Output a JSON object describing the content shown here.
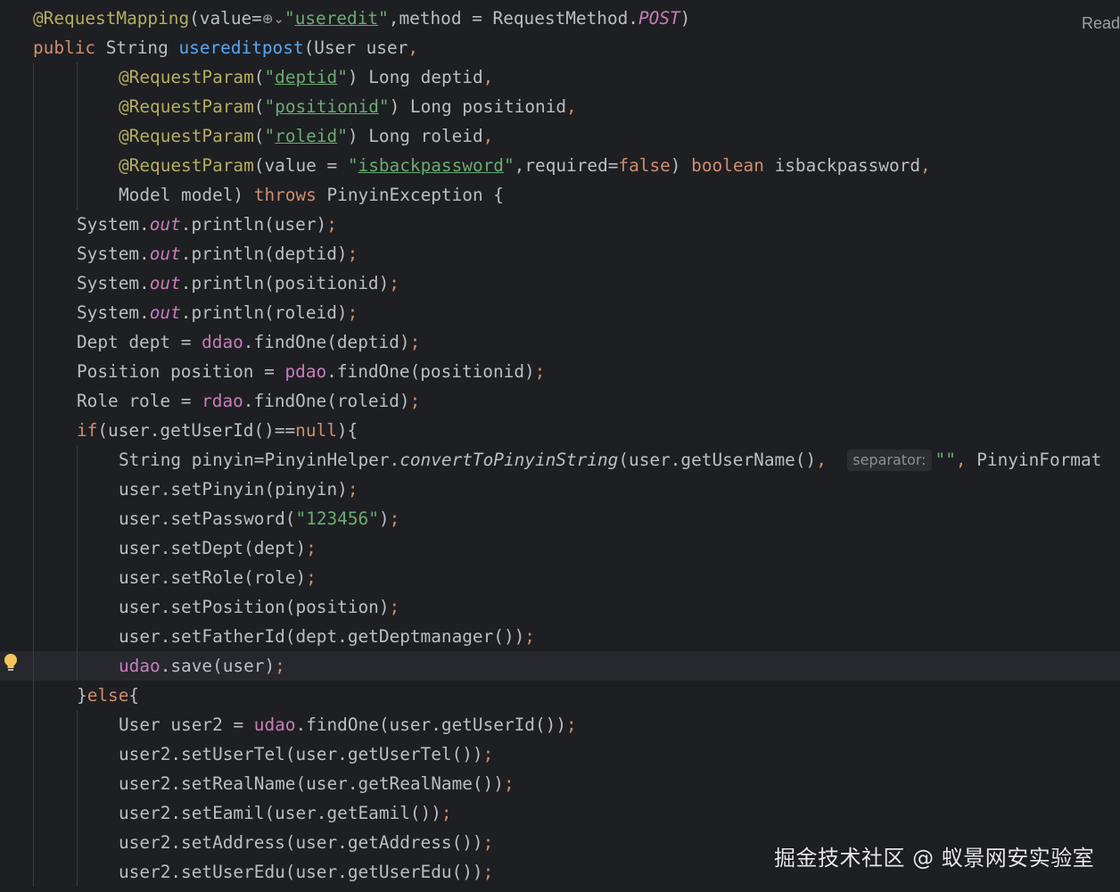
{
  "editor": {
    "reader_mode_label": "Read",
    "watermark": "掘金技术社区 @ 蚁景网安实验室",
    "inlay_hint": "separator:",
    "lines": [
      {
        "indent": 0,
        "tokens": [
          [
            "ann",
            "@RequestMapping"
          ],
          [
            "punc",
            "(value="
          ],
          [
            "globe",
            ""
          ],
          [
            "str",
            "\""
          ],
          [
            "strul",
            "useredit"
          ],
          [
            "str",
            "\""
          ],
          [
            "punc",
            ",method = RequestMethod."
          ],
          [
            "field-s",
            "POST"
          ],
          [
            "punc",
            ")"
          ]
        ]
      },
      {
        "indent": 0,
        "tokens": [
          [
            "kw",
            "public "
          ],
          [
            "punc",
            "String "
          ],
          [
            "fn",
            "usereditpost"
          ],
          [
            "punc",
            "(User user"
          ],
          [
            "kw",
            ","
          ]
        ]
      },
      {
        "indent": 2,
        "tokens": [
          [
            "ann",
            "@RequestParam"
          ],
          [
            "punc",
            "("
          ],
          [
            "str",
            "\""
          ],
          [
            "strul",
            "deptid"
          ],
          [
            "str",
            "\""
          ],
          [
            "punc",
            ") Long deptid"
          ],
          [
            "kw",
            ","
          ]
        ]
      },
      {
        "indent": 2,
        "tokens": [
          [
            "ann",
            "@RequestParam"
          ],
          [
            "punc",
            "("
          ],
          [
            "str",
            "\""
          ],
          [
            "strul",
            "positionid"
          ],
          [
            "str",
            "\""
          ],
          [
            "punc",
            ") Long positionid"
          ],
          [
            "kw",
            ","
          ]
        ]
      },
      {
        "indent": 2,
        "tokens": [
          [
            "ann",
            "@RequestParam"
          ],
          [
            "punc",
            "("
          ],
          [
            "str",
            "\""
          ],
          [
            "strul",
            "roleid"
          ],
          [
            "str",
            "\""
          ],
          [
            "punc",
            ") Long roleid"
          ],
          [
            "kw",
            ","
          ]
        ]
      },
      {
        "indent": 2,
        "tokens": [
          [
            "ann",
            "@RequestParam"
          ],
          [
            "punc",
            "(value = "
          ],
          [
            "str",
            "\""
          ],
          [
            "strul",
            "isbackpassword"
          ],
          [
            "str",
            "\""
          ],
          [
            "punc",
            ",required="
          ],
          [
            "kw",
            "false"
          ],
          [
            "punc",
            ") "
          ],
          [
            "kw",
            "boolean "
          ],
          [
            "punc",
            "isbackpassword"
          ],
          [
            "kw",
            ","
          ]
        ]
      },
      {
        "indent": 2,
        "tokens": [
          [
            "punc",
            "Model model) "
          ],
          [
            "kw",
            "throws "
          ],
          [
            "punc",
            "PinyinException {"
          ]
        ]
      },
      {
        "indent": 1,
        "tokens": [
          [
            "punc",
            "System."
          ],
          [
            "field-s",
            "out"
          ],
          [
            "punc",
            ".println(user)"
          ],
          [
            "kw",
            ";"
          ]
        ]
      },
      {
        "indent": 1,
        "tokens": [
          [
            "punc",
            "System."
          ],
          [
            "field-s",
            "out"
          ],
          [
            "punc",
            ".println(deptid)"
          ],
          [
            "kw",
            ";"
          ]
        ]
      },
      {
        "indent": 1,
        "tokens": [
          [
            "punc",
            "System."
          ],
          [
            "field-s",
            "out"
          ],
          [
            "punc",
            ".println(positionid)"
          ],
          [
            "kw",
            ";"
          ]
        ]
      },
      {
        "indent": 1,
        "tokens": [
          [
            "punc",
            "System."
          ],
          [
            "field-s",
            "out"
          ],
          [
            "punc",
            ".println(roleid)"
          ],
          [
            "kw",
            ";"
          ]
        ]
      },
      {
        "indent": 1,
        "tokens": [
          [
            "punc",
            "Dept dept = "
          ],
          [
            "field",
            "ddao"
          ],
          [
            "punc",
            ".findOne(deptid)"
          ],
          [
            "kw",
            ";"
          ]
        ]
      },
      {
        "indent": 1,
        "tokens": [
          [
            "punc",
            "Position position = "
          ],
          [
            "field",
            "pdao"
          ],
          [
            "punc",
            ".findOne(positionid)"
          ],
          [
            "kw",
            ";"
          ]
        ]
      },
      {
        "indent": 1,
        "tokens": [
          [
            "punc",
            "Role role = "
          ],
          [
            "field",
            "rdao"
          ],
          [
            "punc",
            ".findOne(roleid)"
          ],
          [
            "kw",
            ";"
          ]
        ]
      },
      {
        "indent": 1,
        "tokens": [
          [
            "kw",
            "if"
          ],
          [
            "punc",
            "(user.getUserId()=="
          ],
          [
            "kw",
            "null"
          ],
          [
            "punc",
            "){"
          ]
        ]
      },
      {
        "indent": 2,
        "tokens": [
          [
            "punc",
            "String pinyin=PinyinHelper."
          ],
          [
            "fn-s",
            "convertToPinyinString"
          ],
          [
            "punc",
            "(user.getUserName()"
          ],
          [
            "kw",
            ", "
          ],
          [
            "punc",
            " "
          ],
          [
            "hint",
            "separator:"
          ],
          [
            "str",
            "\"\""
          ],
          [
            "kw",
            ", "
          ],
          [
            "punc",
            "PinyinFormat"
          ]
        ]
      },
      {
        "indent": 2,
        "tokens": [
          [
            "punc",
            "user.setPinyin(pinyin)"
          ],
          [
            "kw",
            ";"
          ]
        ]
      },
      {
        "indent": 2,
        "tokens": [
          [
            "punc",
            "user.setPassword("
          ],
          [
            "str",
            "\"123456\""
          ],
          [
            "punc",
            ")"
          ],
          [
            "kw",
            ";"
          ]
        ]
      },
      {
        "indent": 2,
        "tokens": [
          [
            "punc",
            "user.setDept(dept)"
          ],
          [
            "kw",
            ";"
          ]
        ]
      },
      {
        "indent": 2,
        "tokens": [
          [
            "punc",
            "user.setRole(role)"
          ],
          [
            "kw",
            ";"
          ]
        ]
      },
      {
        "indent": 2,
        "tokens": [
          [
            "punc",
            "user.setPosition(position)"
          ],
          [
            "kw",
            ";"
          ]
        ]
      },
      {
        "indent": 2,
        "tokens": [
          [
            "punc",
            "user.setFatherId(dept.getDeptmanager())"
          ],
          [
            "kw",
            ";"
          ]
        ]
      },
      {
        "indent": 2,
        "current": true,
        "tokens": [
          [
            "field",
            "udao"
          ],
          [
            "punc",
            ".save(user)"
          ],
          [
            "kw",
            ";"
          ]
        ]
      },
      {
        "indent": 1,
        "tokens": [
          [
            "punc",
            "}"
          ],
          [
            "kw",
            "else"
          ],
          [
            "punc",
            "{"
          ]
        ]
      },
      {
        "indent": 2,
        "tokens": [
          [
            "punc",
            "User user2 = "
          ],
          [
            "field",
            "udao"
          ],
          [
            "punc",
            ".findOne(user.getUserId())"
          ],
          [
            "kw",
            ";"
          ]
        ]
      },
      {
        "indent": 2,
        "tokens": [
          [
            "punc",
            "user2.setUserTel(user.getUserTel())"
          ],
          [
            "kw",
            ";"
          ]
        ]
      },
      {
        "indent": 2,
        "tokens": [
          [
            "punc",
            "user2.setRealName(user.getRealName())"
          ],
          [
            "kw",
            ";"
          ]
        ]
      },
      {
        "indent": 2,
        "tokens": [
          [
            "punc",
            "user2.setEamil(user.getEamil())"
          ],
          [
            "kw",
            ";"
          ]
        ]
      },
      {
        "indent": 2,
        "tokens": [
          [
            "punc",
            "user2.setAddress(user.getAddress())"
          ],
          [
            "kw",
            ";"
          ]
        ]
      },
      {
        "indent": 2,
        "tokens": [
          [
            "punc",
            "user2.setUserEdu(user.getUserEdu())"
          ],
          [
            "kw",
            ";"
          ]
        ]
      }
    ]
  },
  "colors": {
    "background": "#1e1f22",
    "annotation": "#b3ae60",
    "keyword": "#cf8e6d",
    "string": "#6aab73",
    "method_decl": "#56a8f5",
    "field": "#c77dbb",
    "text": "#bcbec4"
  },
  "icons": {
    "gutter_icon": "lightbulb-icon",
    "inline_icon": "globe-icon"
  }
}
